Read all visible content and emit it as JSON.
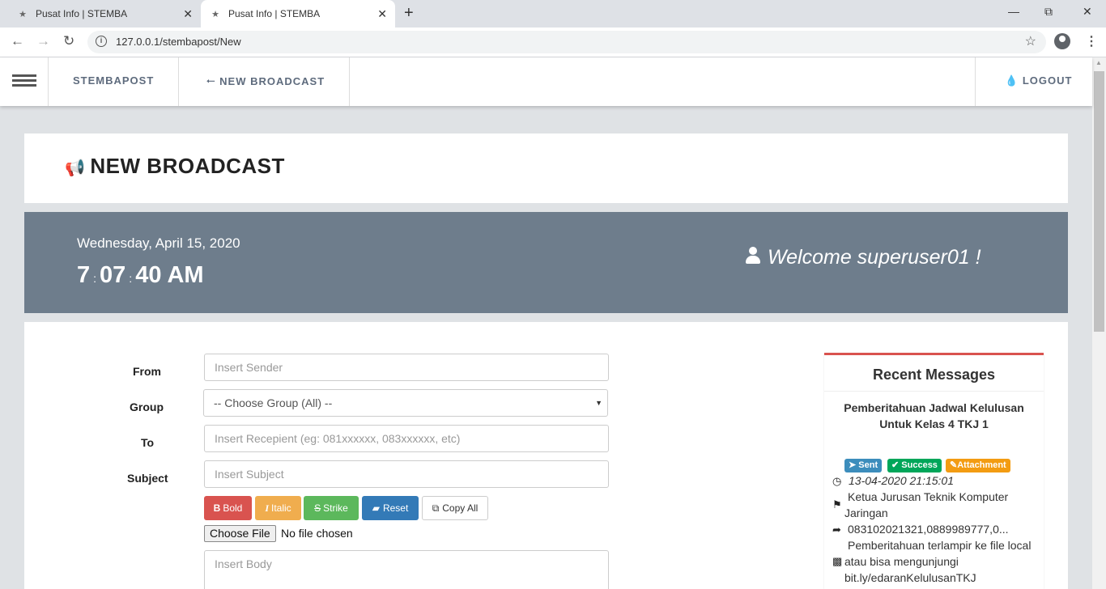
{
  "browser": {
    "tabs": [
      {
        "title": "Pusat Info | STEMBA"
      },
      {
        "title": "Pusat Info | STEMBA"
      }
    ],
    "url": "127.0.0.1/stembapost/New"
  },
  "nav": {
    "brand": "STEMBAPOST",
    "back_label": "NEW BROADCAST",
    "logout_label": "LOGOUT"
  },
  "page": {
    "title": "NEW BROADCAST"
  },
  "banner": {
    "date": "Wednesday, April 15, 2020",
    "hours": "7",
    "minutes": "07",
    "seconds": "40",
    "ampm": "AM",
    "welcome": "Welcome superuser01 !"
  },
  "form": {
    "from_label": "From",
    "from_placeholder": "Insert Sender",
    "group_label": "Group",
    "group_selected": "-- Choose Group (All) --",
    "to_label": "To",
    "to_placeholder": "Insert Recepient (eg: 081xxxxxx, 083xxxxxx, etc)",
    "subject_label": "Subject",
    "subject_placeholder": "Insert Subject",
    "body_placeholder": "Insert Body",
    "buttons": {
      "bold": "Bold",
      "italic": "Italic",
      "strike": "Strike",
      "reset": "Reset",
      "copy": "Copy All"
    },
    "file_button": "Choose File",
    "file_status": "No file chosen"
  },
  "recent": {
    "title": "Recent Messages",
    "message": {
      "title": "Pemberitahuan Jadwal Kelulusan Untuk Kelas 4 TKJ 1",
      "badges": {
        "sent": "Sent",
        "success": "Success",
        "attachment": "Attachment"
      },
      "timestamp": "13-04-2020 21:15:01",
      "sender_line1": "Ketua Jurusan Teknik Komputer",
      "sender_line2": "Jaringan",
      "recipients": "083102021321,0889989777,0...",
      "body_line1": "Pemberitahuan terlampir ke file local",
      "body_line2": "atau bisa mengunjungi",
      "body_line3": "bit.ly/edaranKelulusanTKJ"
    }
  },
  "colors": {
    "banner": "#6e7d8c",
    "bold": "#d9534f",
    "italic": "#f0ad4e",
    "strike": "#5cb85c",
    "reset": "#337ab7",
    "recent_accent": "#d9534f"
  },
  "icons": [
    "megaphone-icon",
    "user-icon",
    "arrow-left-icon",
    "tint-icon",
    "clock-icon",
    "tag-icon",
    "share-icon",
    "file-icon",
    "paper-plane-icon",
    "check-icon",
    "paperclip-icon",
    "eraser-icon",
    "copy-icon"
  ]
}
